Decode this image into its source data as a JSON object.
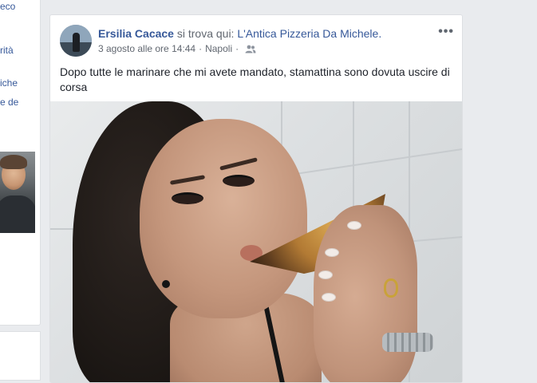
{
  "left_column": {
    "fragments": [
      "eco",
      "rità",
      "iche",
      "e de"
    ]
  },
  "post": {
    "author": "Ersilia Cacace",
    "verb": "si trova qui:",
    "place": "L'Antica Pizzeria Da Michele.",
    "date": "3 agosto alle ore 14:44",
    "location": "Napoli",
    "separator": "·",
    "more_label": "•••",
    "audience_icon": "friends-icon",
    "text": "Dopo tutte le marinare che mi avete mandato, stamattina sono dovuta uscire di corsa"
  },
  "colors": {
    "link": "#365899",
    "secondary_text": "#616770",
    "background": "#e9ebee"
  }
}
